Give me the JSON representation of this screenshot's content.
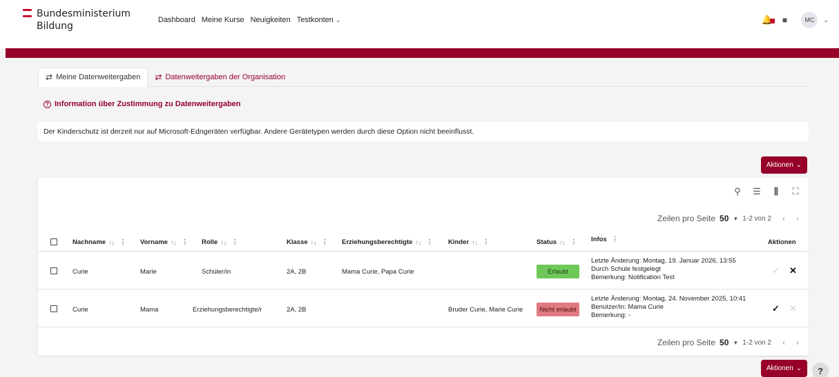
{
  "header": {
    "brand_line1": "Bundesministerium",
    "brand_line2": "Bildung",
    "nav": [
      "Dashboard",
      "Meine Kurse",
      "Neuigkeiten",
      "Testkonten"
    ],
    "avatar_initials": "MC"
  },
  "tabs": {
    "mine": "Meine Datenweitergaben",
    "org": "Datenweitergaben der Organisation"
  },
  "info_link": "Information über Zustimmung zu Datenweitergaben",
  "notice": "Der Kinderschutz ist derzeit nur auf Microsoft-Edngeräten verfügbar. Andere Gerätetypen werden durch diese Option nicht beeinflusst.",
  "actions_label": "Aktionen",
  "pager": {
    "rows_label": "Zeilen pro Seite",
    "rows_value": "50",
    "range": "1-2 von 2"
  },
  "table": {
    "columns": {
      "nachname": "Nachname",
      "vorname": "Vorname",
      "rolle": "Rolle",
      "klasse": "Klasse",
      "erz": "Erziehungsberechtigte",
      "kinder": "Kinder",
      "status": "Status",
      "infos": "Infos",
      "aktionen": "Aktionen"
    },
    "rows": [
      {
        "nachname": "Curie",
        "vorname": "Marie",
        "rolle": "Schüler/in",
        "klasse": "2A, 2B",
        "erz": "Mama Curie, Papa Curie",
        "kinder": "",
        "status": "Erlaubt",
        "info1": "Letzte Änderung: Montag, 19. Januar 2026, 13:55",
        "info2": "Durch Schule festgelegt",
        "info3": "Bemerkung: Notification Test"
      },
      {
        "nachname": "Curie",
        "vorname": "Mama",
        "rolle": "Erziehungsberechtigte/r",
        "klasse": "2A, 2B",
        "erz": "",
        "kinder": "Bruder Curie, Marie Curie",
        "status": "Nicht erlaubt",
        "info1": "Letzte Änderung: Montag, 24. November 2025, 10:41",
        "info2": "Benutzer/in: Mama Curie",
        "info3": "Bemerkung: -"
      }
    ]
  },
  "colors": {
    "brand": "#96002a",
    "allowed": "#70c75a",
    "denied": "#e07a80"
  }
}
